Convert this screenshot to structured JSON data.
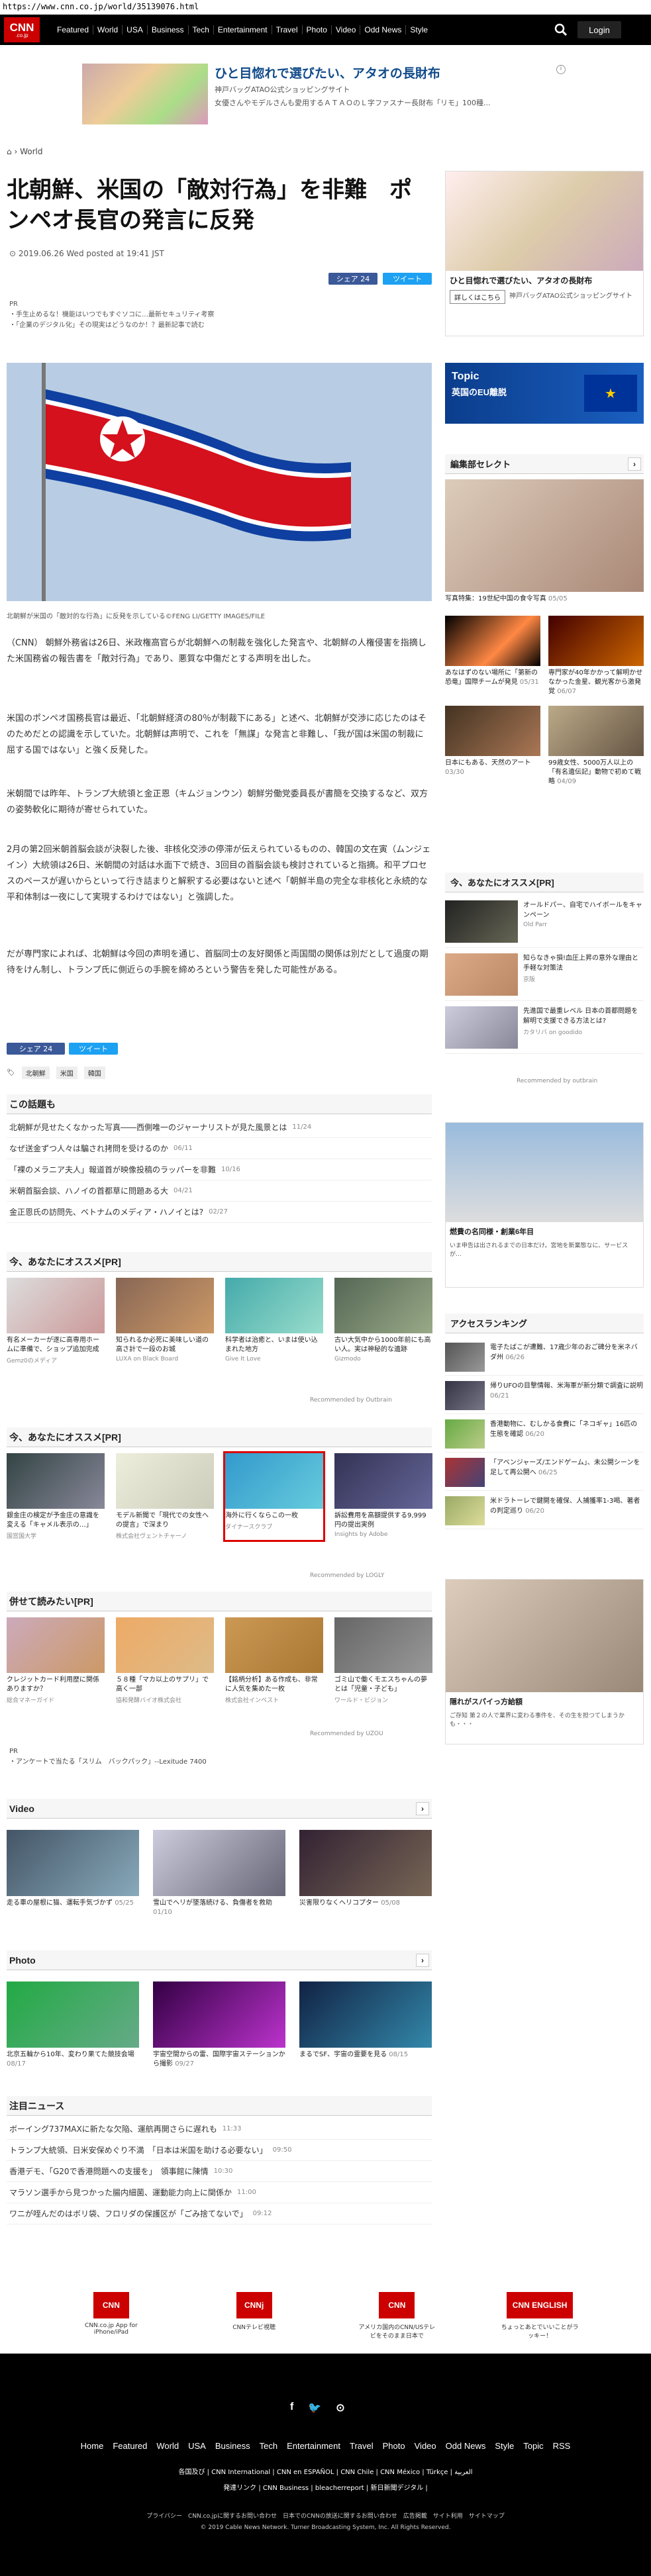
{
  "url": "https://www.cnn.co.jp/world/35139076.html",
  "nav": {
    "logo": "CNN",
    "logo_sub": ".co.jp",
    "items": [
      "Featured",
      "World",
      "USA",
      "Business",
      "Tech",
      "Entertainment",
      "Travel",
      "Photo",
      "Video",
      "Odd News",
      "Style"
    ],
    "login": "Login"
  },
  "topad": {
    "title": "ひと目惚れで選びたい、アタオの長財布",
    "sub1": "神戸バッグATAO公式ショッピングサイト",
    "sub2": "女優さんやモデルさんも愛用するＡＴＡＯのＬ字ファスナー長財布「リモ」100種..."
  },
  "breadcrumb": "World",
  "article": {
    "title": "北朝鮮、米国の「敵対行為」を非難　ポンペオ長官の発言に反発",
    "date": "2019.06.26 Wed posted at 19:41 JST",
    "share": "シェア 24",
    "tweet": "ツイート",
    "pr_label": "PR",
    "pr1": "・手生止めるな！機能はいつでもすぐソコに…最新セキュリティ考察",
    "pr2": "・「企業のデジタル化」その現実はどうなのか！？最新記事で読む",
    "caption": "北朝鮮が米国の「敵対的な行為」に反発を示している©FENG LI/GETTY IMAGES/FILE",
    "p1": "（CNN） 朝鮮外務省は26日、米政権高官らが北朝鮮への制裁を強化した発言や、北朝鮮の人権侵害を指摘した米国務省の報告書を「敵対行為」であり、悪質な中傷だとする声明を出した。",
    "p2": "米国のポンペオ国務長官は最近、「北朝鮮経済の80％が制裁下にある」と述べ、北朝鮮が交渉に応じたのはそのためだとの認識を示していた。北朝鮮は声明で、これを「無謀」な発言と非難し、「我が国は米国の制裁に屈する国ではない」と強く反発した。",
    "p3": "米朝間では昨年、トランプ大統領と金正恩（キムジョンウン）朝鮮労働党委員長が書簡を交換するなど、双方の姿勢軟化に期待が寄せられていた。",
    "p4": "2月の第2回米朝首脳会談が決裂した後、非核化交渉の停滞が伝えられているものの、韓国の文在寅（ムンジェイン）大統領は26日、米朝間の対話は水面下で続き、3回目の首脳会談も検討されていると指摘。和平プロセスのペースが遅いからといって行き詰まりと解釈する必要はないと述べ「朝鮮半島の完全な非核化と永続的な平和体制は一夜にして実現するわけではない」と強調した。",
    "p5": "だが専門家によれば、北朝鮮は今回の声明を通じ、首脳同士の友好関係と両国間の関係は別だとして過度の期待をけん制し、トランプ氏に側近らの手腕を締めろという警告を発した可能性がある。",
    "tags": [
      "北朝鮮",
      "米国",
      "韓国"
    ]
  },
  "related": {
    "title": "この話題も",
    "items": [
      {
        "t": "北朝鮮が見せたくなかった写真――西側唯一のジャーナリストが見た風景とは",
        "d": "11/24"
      },
      {
        "t": "なぜ送金ずつ人々は騙され拷問を受けるのか",
        "d": "06/11"
      },
      {
        "t": "「裸のメラニア夫人」報道首が映像投稿のラッパーを非難",
        "d": "10/16"
      },
      {
        "t": "米朝首脳会談、ハノイの首都草に問題ある大",
        "d": "04/21"
      },
      {
        "t": "金正恩氏の訪問先、ベトナムのメディア・ハノイとは?",
        "d": "02/27"
      }
    ]
  },
  "rec1": {
    "title": "今、あなたにオススメ[PR]",
    "cards": [
      {
        "t": "有名メーカーが遂に高専用ホームに準備で、ショップ追加完成",
        "s": "Gemz0のメディア"
      },
      {
        "t": "知られるか必死に美味しい道の高さ計で一段のお城",
        "s": "LUXA on Black Board"
      },
      {
        "t": "科学者は治癒と、いまは使い込まれた地方",
        "s": "Give It Love"
      },
      {
        "t": "古い大気中から1000年前にも高い人。実は神秘的な遺跡",
        "s": "Gizmodo"
      }
    ],
    "by": "Recommended by Outbrain"
  },
  "rec2": {
    "title": "今、あなたにオススメ[PR]",
    "cards": [
      {
        "t": "銀金庄の検定が予金庄の意識を変える「キャメル表示の…」",
        "s": "国営国大学"
      },
      {
        "t": "モデル新聞で「現代での女性への提言」で深まり",
        "s": "株式会社ヴェントチャーノ"
      },
      {
        "t": "海外に行くならこの一枚",
        "s": "ダイナースクラブ"
      },
      {
        "t": "訴訟費用を高額提供する9,999円の提出実例",
        "s": "Insights by Adobe"
      }
    ],
    "by": "Recommended by LOGLY"
  },
  "rec3": {
    "title": "併せて読みたい[PR]",
    "cards": [
      {
        "t": "クレジットカード利用歴に関係ありますか？",
        "s": "総合マネーガイド"
      },
      {
        "t": "５８種「マカ以上のサプリ」で高く一部",
        "s": "協和発酵バイオ株式会社"
      },
      {
        "t": "【銘柄分析】ある作成も、非常に人気を集めた一枚",
        "s": "株式会社インベスト"
      },
      {
        "t": "ゴミ山で働くモエスちゃんの夢とは「児童・子ども」",
        "s": "ワールド・ビジョン"
      }
    ],
    "by": "Recommended by UZOU"
  },
  "pr_bottom": "PR\n・アンケートで当たる「スリム　バックパック」--Lexitude 7400",
  "video": {
    "title": "Video",
    "items": [
      {
        "t": "走る車の屋根に猫、運転手気づかず",
        "d": "05/25"
      },
      {
        "t": "雪山でヘリが墜落続ける、負傷者を救助",
        "d": "01/10"
      },
      {
        "t": "災害限りなくヘリコプター",
        "d": "05/08"
      }
    ]
  },
  "photo": {
    "title": "Photo",
    "items": [
      {
        "t": "北京五輪から10年、変わり果てた競技会場",
        "d": "08/17"
      },
      {
        "t": "宇宙空間からの雷、国際宇宙ステーションから撮影",
        "d": "09/27"
      },
      {
        "t": "まるでSF、宇宙の霊要を見る",
        "d": "08/15"
      }
    ]
  },
  "news": {
    "title": "注目ニュース",
    "items": [
      {
        "t": "ボーイング737MAXに新たな欠陥、運航再開さらに遅れも",
        "d": "11:33"
      },
      {
        "t": "トランプ大統領、日米安保めぐり不満　「日本は米国を助ける必要ない」",
        "d": "09:50"
      },
      {
        "t": "香港デモ、「G20で香港問題への支援を」　領事館に陳情",
        "d": "10:30"
      },
      {
        "t": "マラソン選手から見つかった腸内細菌、運動能力向上に関係か",
        "d": "11:00"
      },
      {
        "t": "ワニが咥んだのはボリ袋、フロリダの保護区が「ごみ捨てないで」",
        "d": "09:12"
      }
    ]
  },
  "side": {
    "ad_title": "ひと目惚れで選びたい、アタオの長財布",
    "ad_sub": "神戸バッグATAO公式ショッピングサイト",
    "ad_btn": "詳しくはこちら",
    "topic": "Topic",
    "topic_sub": "英国のEU離脱",
    "edit_title": "編集部セレクト",
    "edit_items": [
      {
        "t": "写真特集：19世紀中国の食令写真",
        "d": "05/05"
      },
      {
        "t": "あなはずのない場所に「第新の恐竜」国際チームが発見",
        "d": "05/31"
      },
      {
        "t": "専門家が40年かかって解明かせなかった金星、観光客から激発覚",
        "d": "06/07"
      },
      {
        "t": "日本にもある、天然のアート",
        "d": "03/30"
      },
      {
        "t": "99歳女性、5000万人以上の「有名遺伝記」動物で初めて戦略",
        "d": "04/09"
      }
    ],
    "osusume_title": "今、あなたにオススメ[PR]",
    "osusume": [
      {
        "t": "オールドパー、自宅でハイボールをキャンペーン",
        "s": "Old Parr"
      },
      {
        "t": "知らなきゃ損!血圧上昇の意外な理由と手軽な対策法",
        "s": "京阪"
      },
      {
        "t": "先進国で最重レベル 日本の首都問題を解明で支援できる方法とは?",
        "s": "カタリバ on goodido"
      }
    ],
    "osusume_by": "Recommended by outbrain",
    "ad2_title": "燃費の名同様・創業6年目",
    "ad2_sub": "いま申告は出されるまでの日本だけ。宮地を新業態なに、サービスが…",
    "rank_title": "アクセスランキング",
    "rank": [
      {
        "t": "電子たばこが遭難、17歳少年のおご碑分を米ネバダ州",
        "d": "06/26"
      },
      {
        "t": "帰りUFOの目撃情報、米海軍が新分類で調査に説明",
        "d": "06/21"
      },
      {
        "t": "香港動物に、むしかる食費に「ネコギャ」16匹の生態を確認",
        "d": "06/20"
      },
      {
        "t": "「アベンジャーズ/エンドゲーム」、未公開シーンを足して再公開へ",
        "d": "06/25"
      },
      {
        "t": "米ドラトーレで鍵開を確保、人捕獲率1-3喝、著者の判定巡り",
        "d": "06/20"
      }
    ],
    "ad3_title": "隠れがスパイっ方給額",
    "ad3_sub": "ご存知 第２の人で業界に変わる事件を、その生を担つてしまうかも・・・"
  },
  "footer_apps": [
    {
      "l": "CNN.co.jp App for iPhone/iPad"
    },
    {
      "l": "CNNテレビ視聴"
    },
    {
      "l": "アメリカ国内のCNN/USテレビをそのまま日本で"
    },
    {
      "l": "ちょっとあとでいいことがラッキー！"
    }
  ],
  "footer": {
    "links": [
      "Home",
      "Featured",
      "World",
      "USA",
      "Business",
      "Tech",
      "Entertainment",
      "Travel",
      "Photo",
      "Video",
      "Odd News",
      "Style",
      "Topic",
      "RSS"
    ],
    "sub1": "各国及び | CNN International | CNN en ESPAÑOL | CNN Chile | CNN México | Türkçe | العربية",
    "sub2": "発達リンク | CNN Business | bleacherreport | 新日新聞デジタル |",
    "sub3": "プライバシー　CNN.co.jpに関するお問い合わせ　日本でのCNNの放送に関するお問い合わせ　広告掲載　サイト利用　サイトマップ",
    "copyright": "© 2019 Cable News Network. Turner Broadcasting System, Inc. All Rights Reserved."
  }
}
